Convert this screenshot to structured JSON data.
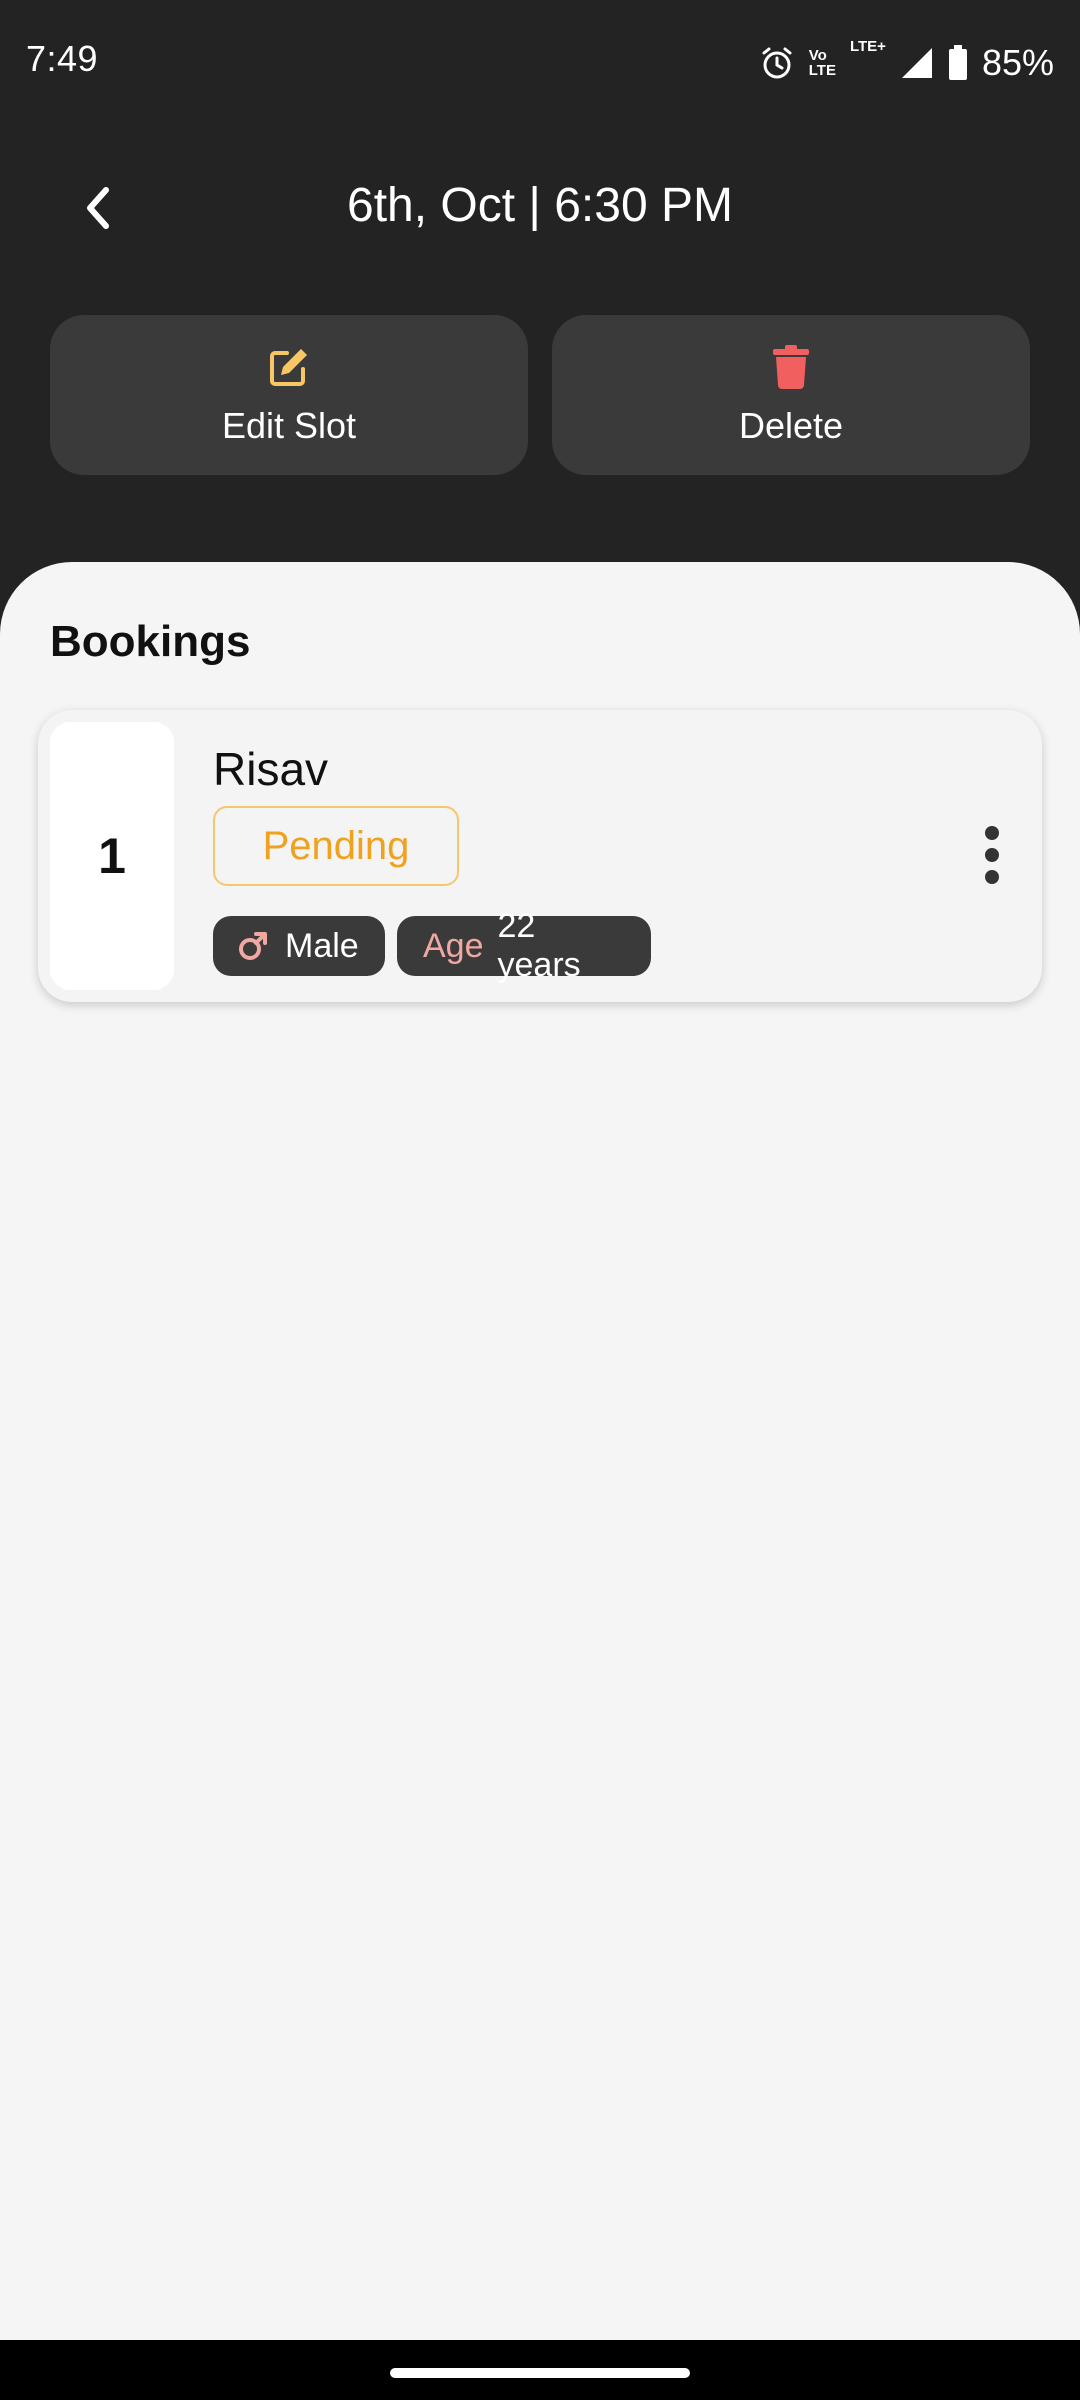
{
  "status_bar": {
    "time": "7:49",
    "volte_top": "Vo",
    "volte_bottom": "LTE",
    "network": "LTE+",
    "battery": "85%",
    "icons": [
      "alarm-icon",
      "volte-icon",
      "signal-icon",
      "battery-icon"
    ]
  },
  "header": {
    "title": "6th, Oct | 6:30 PM",
    "back_icon": "chevron-left-icon"
  },
  "actions": {
    "edit_label": "Edit Slot",
    "edit_icon": "edit-icon",
    "delete_label": "Delete",
    "delete_icon": "trash-icon"
  },
  "bookings": {
    "title": "Bookings",
    "items": [
      {
        "index": "1",
        "name": "Risav",
        "status": "Pending",
        "gender": "Male",
        "age_label": "Age",
        "age_value": "22 years"
      }
    ]
  },
  "colors": {
    "background_dark": "#232323",
    "sheet": "#f5f5f5",
    "button": "#3a3a3a",
    "edit_icon": "#f7c766",
    "delete_icon": "#f25f5f",
    "pending": "#f0a21e",
    "pending_border": "#f5c66e",
    "gender_icon": "#f0a8a0"
  }
}
